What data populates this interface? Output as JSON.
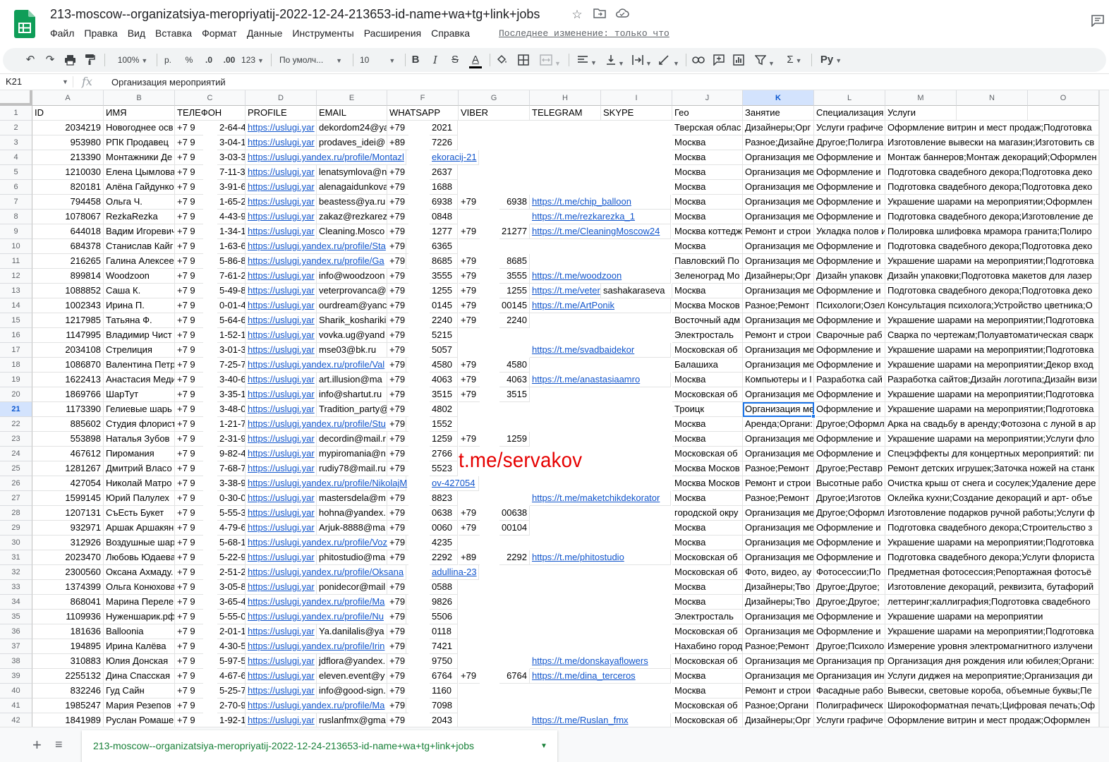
{
  "document": {
    "title": "213-moscow--organizatsiya-meropriyatij-2022-12-24-213653-id-name+wa+tg+link+jobs",
    "last_edit": "Последнее изменение: только что"
  },
  "menu": [
    "Файл",
    "Правка",
    "Вид",
    "Вставка",
    "Формат",
    "Данные",
    "Инструменты",
    "Расширения",
    "Справка"
  ],
  "toolbar": {
    "zoom": "100%",
    "currency": "р.",
    "percent": "%",
    "decimal_decrease": ".0",
    "decimal_increase": ".00",
    "format_more": "123",
    "font": "По умолч...",
    "font_size": "10",
    "input_tools": "Ру"
  },
  "formula_bar": {
    "cell_ref": "K21",
    "fx": "fx",
    "value": "Организация мероприятий"
  },
  "columns": [
    "A",
    "B",
    "C",
    "D",
    "E",
    "F",
    "G",
    "H",
    "I",
    "J",
    "K",
    "L",
    "M",
    "N",
    "O"
  ],
  "selected_column": "K",
  "selected_row": "21",
  "row_numbers": [
    "1",
    "2",
    "3",
    "4",
    "5",
    "6",
    "7",
    "8",
    "9",
    "10",
    "11",
    "12",
    "13",
    "14",
    "15",
    "16",
    "17",
    "18",
    "19",
    "20",
    "21",
    "22",
    "23",
    "24",
    "25",
    "26",
    "27",
    "28",
    "29",
    "30",
    "31",
    "32",
    "33",
    "34",
    "35",
    "36",
    "37",
    "38",
    "39",
    "40",
    "41",
    "42"
  ],
  "header_row": [
    "ID",
    "ИМЯ",
    "ТЕЛЕФОН",
    "PROFILE",
    "EMAIL",
    "WHATSAPP",
    "VIBER",
    "TELEGRAM",
    "SKYPE",
    "Гео",
    "Занятие",
    "Специализация",
    "Услуги",
    "",
    ""
  ],
  "rows": [
    [
      "2034219",
      "Новогоднее осв",
      "+7 9",
      "2-64-4",
      "https://uslugi.yar",
      "dekordom24@ya",
      "+79",
      "2021",
      "",
      "",
      "",
      "",
      "Тверская облас",
      "Дизайнеры;Орг",
      "Услуги графиче",
      "Оформление витрин и мест продаж;Подготовка"
    ],
    [
      "953980",
      "РПК Продавец",
      "+7 9",
      "3-04-1",
      "https://uslugi.yar",
      "prodaves_idei@",
      "+89",
      "7226",
      "",
      "",
      "",
      "",
      "Москва",
      "Разное;Дизайне",
      "Другое;Полигра",
      "Изготовление вывески на магазин;Изготовить св"
    ],
    [
      "213390",
      "Монтажники Де",
      "+7 9",
      "3-03-3",
      "https://uslugi.yandex.ru/profile/Montazl",
      "",
      "",
      "ekoracij-21",
      "",
      "",
      "",
      "",
      "Москва",
      "Организация ме",
      "Оформление и",
      "Монтаж баннеров;Монтаж декораций;Оформлен"
    ],
    [
      "1210030",
      "Елена Цымлова",
      "+7 9",
      "7-11-3",
      "https://uslugi.yar",
      "lenatsymlova@n",
      "+79",
      "2637",
      "",
      "",
      "",
      "",
      "Москва",
      "Организация ме",
      "Оформление и",
      "Подготовка свадебного декора;Подготовка деко"
    ],
    [
      "820181",
      "Алёна Гайдунко",
      "+7 9",
      "3-91-6",
      "https://uslugi.yar",
      "alenagaidunkova",
      "+79",
      "1688",
      "",
      "",
      "",
      "",
      "Москва",
      "Организация ме",
      "Оформление и",
      "Подготовка свадебного декора;Подготовка деко"
    ],
    [
      "794458",
      "Ольга Ч.",
      "+7 9",
      "1-65-2",
      "https://uslugi.yar",
      "beastess@ya.ru",
      "+79",
      "6938",
      "+79",
      "6938",
      "https://t.me/chip_balloon",
      "",
      "Москва",
      "Организация ме",
      "Оформление и",
      "Украшение шарами на мероприятии;Оформлен"
    ],
    [
      "1078067",
      "RezkaRezka",
      "+7 9",
      "4-43-9",
      "https://uslugi.yar",
      "zakaz@rezkarez",
      "+79",
      "0848",
      "",
      "",
      "https://t.me/rezkarezka_1",
      "",
      "Москва",
      "Организация ме",
      "Оформление и",
      "Подготовка свадебного декора;Изготовление де"
    ],
    [
      "644018",
      "Вадим Игоревич",
      "+7 9",
      "1-34-1",
      "https://uslugi.yar",
      "Cleaning.Mosco",
      "+79",
      "1277",
      "+79",
      "21277",
      "https://t.me/CleaningMoscow24",
      "",
      "Москва коттедж",
      "Ремонт и строи",
      "Укладка полов и",
      "Полировка шлифовка мрамора гранита;Полиро"
    ],
    [
      "684378",
      "Станислав Кайг",
      "+7 9",
      "1-63-6",
      "https://uslugi.yandex.ru/profile/Sta",
      "",
      "+79",
      "6365",
      "",
      "",
      "",
      "",
      "Москва",
      "Организация ме",
      "Оформление и",
      "Подготовка свадебного декора;Подготовка деко"
    ],
    [
      "216265",
      "Галина Алексее",
      "+7 9",
      "5-86-8",
      "https://uslugi.yandex.ru/profile/Ga",
      "",
      "+79",
      "8685",
      "+79",
      "8685",
      "",
      "",
      "Павловский По",
      "Организация ме",
      "Оформление и",
      "Украшение шарами на мероприятии;Подготовка"
    ],
    [
      "899814",
      "Woodzoon",
      "+7 9",
      "7-61-2",
      "https://uslugi.yar",
      "info@woodzoon",
      "+79",
      "3555",
      "+79",
      "3555",
      "https://t.me/woodzoon",
      "",
      "Зеленоград Мо",
      "Дизайнеры;Орг",
      "Дизайн упаковк",
      "Дизайн упаковки;Подготовка макетов для лазер"
    ],
    [
      "1088852",
      "Саша К.",
      "+7 9",
      "5-49-8",
      "https://uslugi.yar",
      "veterprovanca@",
      "+79",
      "1255",
      "+79",
      "1255",
      "https://t.me/veter",
      "sashakaraseva",
      "Москва",
      "Организация ме",
      "Оформление и",
      "Подготовка свадебного декора;Подготовка деко"
    ],
    [
      "1002343",
      "Ирина П.",
      "+7 9",
      "0-01-4",
      "https://uslugi.yar",
      "ourdream@yanc",
      "+79",
      "0145",
      "+79",
      "00145",
      "https://t.me/ArtPonik",
      "",
      "Москва Москов",
      "Разное;Ремонт",
      "Психологи;Озел",
      "Консультация психолога;Устройство цветника;О"
    ],
    [
      "1217985",
      "Татьяна Ф.",
      "+7 9",
      "5-64-6",
      "https://uslugi.yar",
      "Sharik_koshariki",
      "+79",
      "2240",
      "+79",
      "2240",
      "",
      "",
      "Восточный адм",
      "Организация ме",
      "Оформление и",
      "Украшение шарами на мероприятии;Подготовка"
    ],
    [
      "1147995",
      "Владимир Чист",
      "+7 9",
      "1-52-1",
      "https://uslugi.yar",
      "vovka.ug@yand",
      "+79",
      "5215",
      "",
      "",
      "",
      "",
      "Электросталь",
      "Ремонт и строи",
      "Сварочные раб",
      "Сварка по чертежам;Полуавтоматическая сварк"
    ],
    [
      "2034108",
      "Стрелиция",
      "+7 9",
      "3-01-3",
      "https://uslugi.yar",
      "mse03@bk.ru",
      "+79",
      "5057",
      "",
      "",
      "https://t.me/svadbaidekor",
      "",
      "Московская об",
      "Организация ме",
      "Оформление и",
      "Украшение шарами на мероприятии;Подготовка"
    ],
    [
      "1086870",
      "Валентина Петр",
      "+7 9",
      "7-25-7",
      "https://uslugi.yandex.ru/profile/Val",
      "",
      "+79",
      "4580",
      "+79",
      "4580",
      "",
      "",
      "Балашиха",
      "Организация ме",
      "Оформление и",
      "Украшение шарами на мероприятии;Декор вход"
    ],
    [
      "1622413",
      "Анастасия Меди",
      "+7 9",
      "3-40-6",
      "https://uslugi.yar",
      "art.illusion@ma",
      "+79",
      "4063",
      "+79",
      "4063",
      "https://t.me/anastasiaamro",
      "",
      "Москва",
      "Компьютеры и I",
      "Разработка сай",
      "Разработка сайтов;Дизайн логотипа;Дизайн визи"
    ],
    [
      "1869766",
      "ШарТут",
      "+7 9",
      "3-35-1",
      "https://uslugi.yar",
      "info@shartut.ru",
      "+79",
      "3515",
      "+79",
      "3515",
      "",
      "",
      "Московская об",
      "Организация ме",
      "Оформление и",
      "Украшение шарами на мероприятии;Подготовка"
    ],
    [
      "1173390",
      "Гелиевые шарь",
      "+7 9",
      "3-48-0",
      "https://uslugi.yar",
      "Tradition_party@",
      "+79",
      "4802",
      "",
      "",
      "",
      "",
      "Троицк",
      "Организация ме",
      "Оформление и",
      "Украшение шарами на мероприятии;Подготовка"
    ],
    [
      "885602",
      "Студия флорист",
      "+7 9",
      "1-21-7",
      "https://uslugi.yandex.ru/profile/Stu",
      "",
      "+79",
      "1552",
      "",
      "",
      "",
      "",
      "Москва",
      "Аренда;Органи:",
      "Другое;Оформл",
      "Арка на свадьбу в аренду;Фотозона с луной в ар"
    ],
    [
      "553898",
      "Наталья Зубов",
      "+7 9",
      "2-31-9",
      "https://uslugi.yar",
      "decordin@mail.r",
      "+79",
      "1259",
      "+79",
      "1259",
      "",
      "",
      "Москва",
      "Организация ме",
      "Оформление и",
      "Украшение шарами на мероприятии;Услуги фло"
    ],
    [
      "467612",
      "Пиромания",
      "+7 9",
      "9-82-4",
      "https://uslugi.yar",
      "mypiromania@n",
      "+79",
      "2766",
      "",
      "",
      "",
      "",
      "Московская об",
      "Организация ме",
      "Оформление и",
      "Спецэффекты для концертных мероприятий: пи"
    ],
    [
      "1281267",
      "Дмитрий Власо",
      "+7 9",
      "7-68-7",
      "https://uslugi.yar",
      "rudiy78@mail.ru",
      "+79",
      "5523",
      "",
      "",
      "",
      "",
      "Москва Москов",
      "Разное;Ремонт",
      "Другое;Реставр",
      "Ремонт детских игрушек;Заточка ножей на станк"
    ],
    [
      "427054",
      "Николай Матро",
      "+7 9",
      "3-38-9",
      "https://uslugi.yandex.ru/profile/NikolajM",
      "",
      "",
      "ov-427054",
      "",
      "",
      "",
      "",
      "Москва Москов",
      "Ремонт и строи",
      "Высотные рабо",
      "Очистка крыш от снега и сосулек;Удаление дере"
    ],
    [
      "1599145",
      "Юрий Палулех",
      "+7 9",
      "0-30-0",
      "https://uslugi.yar",
      "mastersdela@m",
      "+79",
      "8823",
      "",
      "",
      "https://t.me/maketchikdekorator",
      "",
      "Москва",
      "Разное;Ремонт",
      "Другое;Изготов",
      "Оклейка кухни;Создание декораций и арт- объе"
    ],
    [
      "1207131",
      "СъЕсть Букет",
      "+7 9",
      "5-55-3",
      "https://uslugi.yar",
      "hohna@yandex.",
      "+79",
      "0638",
      "+79",
      "00638",
      "",
      "",
      "городской окру",
      "Организация ме",
      "Другое;Оформл",
      "Изготовление подарков ручной работы;Услуги ф"
    ],
    [
      "932971",
      "Аршак Аршакян",
      "+7 9",
      "4-79-6",
      "https://uslugi.yar",
      "Arjuk-8888@ma",
      "+79",
      "0060",
      "+79",
      "00104",
      "",
      "",
      "Москва",
      "Организация ме",
      "Оформление и",
      "Подготовка свадебного декора;Строительство з"
    ],
    [
      "312926",
      "Воздушные шар",
      "+7 9",
      "5-68-1",
      "https://uslugi.yandex.ru/profile/Voz",
      "",
      "+79",
      "4235",
      "",
      "",
      "",
      "",
      "Москва",
      "Организация ме",
      "Оформление и",
      "Украшение шарами на мероприятии;Подготовка"
    ],
    [
      "2023470",
      "Любовь Юдаева",
      "+7 9",
      "5-22-9",
      "https://uslugi.yar",
      "phitostudio@ma",
      "+79",
      "2292",
      "+89",
      "2292",
      "https://t.me/phitostudio",
      "",
      "Московская об",
      "Организация ме",
      "Оформление и",
      "Подготовка свадебного декора;Услуги флориста"
    ],
    [
      "2300560",
      "Оксана Ахмаду.",
      "+7 9",
      "2-51-2",
      "https://uslugi.yandex.ru/profile/Oksana",
      "",
      "",
      "adullina-23",
      "",
      "",
      "",
      "",
      "Московская об",
      "Фото, видео, ау",
      "Фотосессии;По",
      "Предметная фотосессия;Репортажная фотосъё"
    ],
    [
      "1374399",
      "Ольга Конюхова",
      "+7 9",
      "3-05-8",
      "https://uslugi.yar",
      "ponidecor@mail",
      "+79",
      "0588",
      "",
      "",
      "",
      "",
      "Москва",
      "Дизайнеры;Тво",
      "Другое;Другое;",
      "Изготовление декораций, реквизита, бутафорий"
    ],
    [
      "868041",
      "Марина Переле",
      "+7 9",
      "3-65-4",
      "https://uslugi.yandex.ru/profile/Ma",
      "",
      "+79",
      "9826",
      "",
      "",
      "",
      "",
      "Москва",
      "Дизайнеры;Тво",
      "Другое;Другое;",
      "леттеринг;каллиграфия;Подготовка свадебного"
    ],
    [
      "1109936",
      "Нуженшарик.рф",
      "+7 9",
      "5-55-0",
      "https://uslugi.yandex.ru/profile/Nu",
      "",
      "+79",
      "5506",
      "",
      "",
      "",
      "",
      "Электросталь",
      "Организация ме",
      "Оформление и",
      "Украшение шарами на мероприятии"
    ],
    [
      "181636",
      "Balloonia",
      "+7 9",
      "2-01-1",
      "https://uslugi.yar",
      "Ya.danilalis@ya",
      "+79",
      "0118",
      "",
      "",
      "",
      "",
      "Московская об",
      "Организация ме",
      "Оформление и",
      "Украшение шарами на мероприятии;Подготовка"
    ],
    [
      "194895",
      "Ирина Калёва",
      "+7 9",
      "4-30-5",
      "https://uslugi.yandex.ru/profile/Irin",
      "",
      "+79",
      "7421",
      "",
      "",
      "",
      "",
      "Нахабино город",
      "Разное;Ремонт",
      "Другое;Психоло",
      "Измерение уровня электромагнитного излучени"
    ],
    [
      "310883",
      "Юлия Донская",
      "+7 9",
      "5-97-5",
      "https://uslugi.yar",
      "jdflora@yandex.",
      "+79",
      "9750",
      "",
      "",
      "https://t.me/donskayaflowers",
      "",
      "Московская об",
      "Организация ме",
      "Организация пр",
      "Организация дня рождения или юбилея;Органи:"
    ],
    [
      "2255132",
      "Дина Спасская",
      "+7 9",
      "4-67-6",
      "https://uslugi.yar",
      "eleven.event@y",
      "+79",
      "6764",
      "+79",
      "6764",
      "https://t.me/dina_terceros",
      "",
      "Москва",
      "Организация ме",
      "Организация ин",
      "Услуги диджея на мероприятие;Организация ди"
    ],
    [
      "832246",
      "Гуд Сайн",
      "+7 9",
      "5-25-7",
      "https://uslugi.yar",
      "info@good-sign.",
      "+79",
      "1160",
      "",
      "",
      "",
      "",
      "Москва",
      "Ремонт и строи",
      "Фасадные рабо",
      "Вывески, световые короба, объемные буквы;Пе"
    ],
    [
      "1985247",
      "Мария Резепов",
      "+7 9",
      "2-70-9",
      "https://uslugi.yandex.ru/profile/Ma",
      "",
      "+79",
      "7098",
      "",
      "",
      "",
      "",
      "Московская об",
      "Разное;Органи",
      "Полиграфическ",
      "Широкоформатная печать;Цифровая печать;Оф"
    ],
    [
      "1841989",
      "Руслан Ромаше",
      "+7 9",
      "1-92-1",
      "https://uslugi.yar",
      "ruslanfmx@gma",
      "+79",
      "2043",
      "",
      "",
      "https://t.me/Ruslan_fmx",
      "",
      "Московская об",
      "Дизайнеры;Орг",
      "Услуги графиче",
      "Оформление витрин и мест продаж;Оформлен"
    ]
  ],
  "watermark": "t.me/servakov",
  "sheet_tab": "213-moscow--organizatsiya-meropriyatij-2022-12-24-213653-id-name+wa+tg+link+jobs",
  "colors": {
    "link": "#1155cc",
    "selection": "#1a73e8",
    "sheet_tab": "#188038",
    "watermark": "#e60000",
    "logo": "#0f9d58"
  }
}
